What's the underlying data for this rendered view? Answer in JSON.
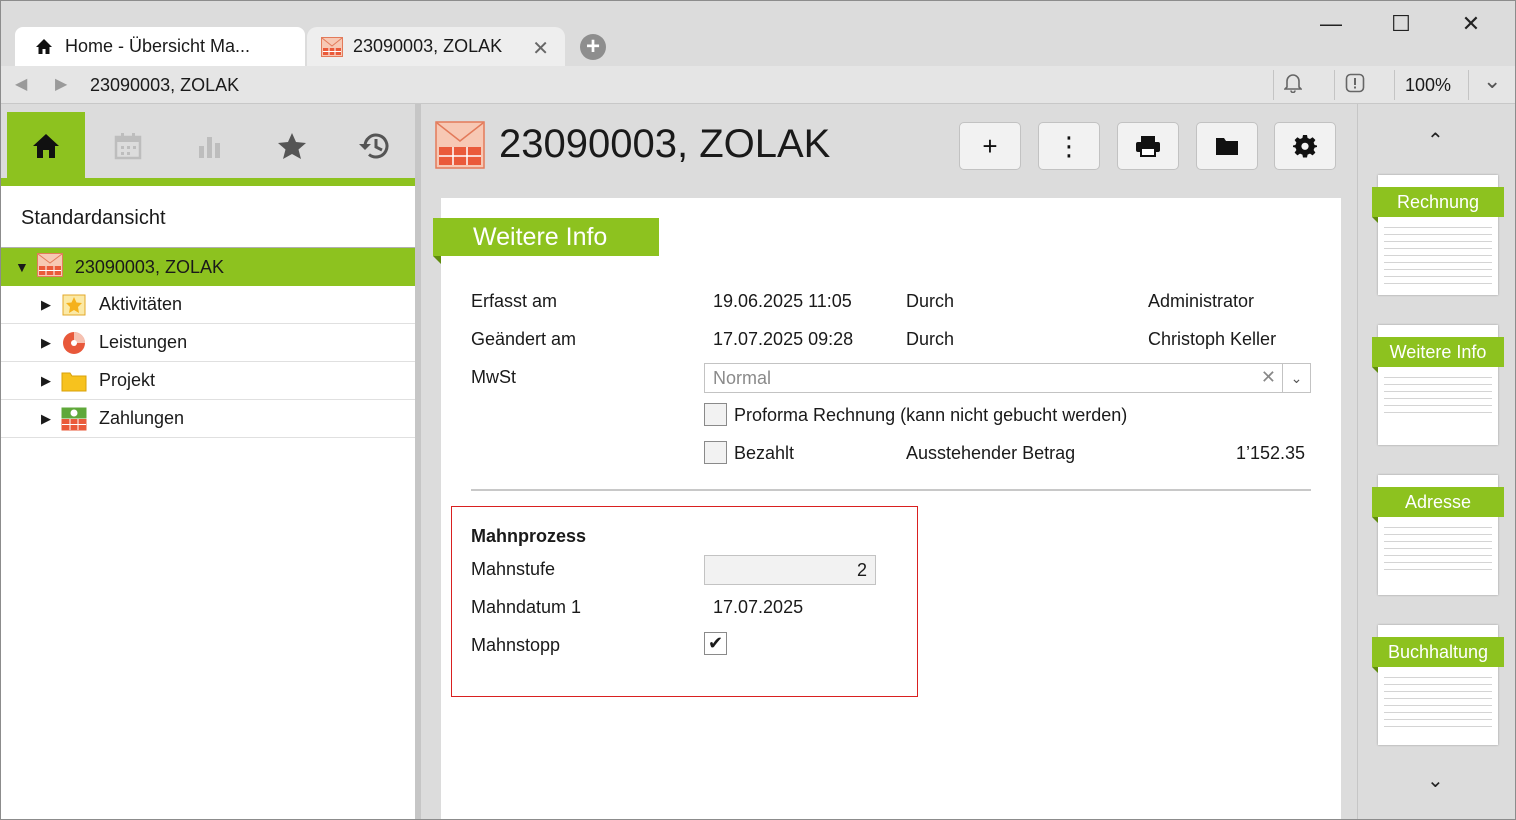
{
  "tabs": {
    "home_label": "Home - Übersicht Ma...",
    "doc_label": "23090003, ZOLAK",
    "close_glyph": "✕",
    "add_glyph": "+"
  },
  "window_controls": {
    "minimize": "—",
    "maximize": "☐",
    "close": "✕"
  },
  "addressbar": {
    "back": "◀",
    "forward": "▶",
    "path": "23090003, ZOLAK",
    "zoom": "100%",
    "dropdown": "⌄"
  },
  "sidebar": {
    "view_name": "Standardansicht",
    "tree_root": {
      "arrow": "▼",
      "label": "23090003, ZOLAK"
    },
    "tree_items": [
      {
        "arrow": "▶",
        "label": "Aktivitäten"
      },
      {
        "arrow": "▶",
        "label": "Leistungen"
      },
      {
        "arrow": "▶",
        "label": "Projekt"
      },
      {
        "arrow": "▶",
        "label": "Zahlungen"
      }
    ]
  },
  "header": {
    "title": "23090003, ZOLAK"
  },
  "toolbar": {
    "add": "+",
    "more": "⋮"
  },
  "section": {
    "title": "Weitere Info",
    "rows": {
      "erfasst_label": "Erfasst am",
      "erfasst_value": "19.06.2025 11:05",
      "erfasst_by_label": "Durch",
      "erfasst_by_value": "Administrator",
      "geaendert_label": "Geändert am",
      "geaendert_value": "17.07.2025 09:28",
      "geaendert_by_label": "Durch",
      "geaendert_by_value": "Christoph Keller",
      "mwst_label": "MwSt",
      "mwst_value": "Normal",
      "mwst_clear": "✕",
      "mwst_dropdown": "⌄",
      "proforma_label": "Proforma Rechnung (kann nicht gebucht werden)",
      "bezahlt_label": "Bezahlt",
      "ausstehend_label": "Ausstehender Betrag",
      "ausstehend_value": "1’152.35"
    },
    "mahn": {
      "title": "Mahnprozess",
      "stufe_label": "Mahnstufe",
      "stufe_value": "2",
      "datum_label": "Mahndatum 1",
      "datum_value": "17.07.2025",
      "stopp_label": "Mahnstopp",
      "stopp_check": "✔"
    }
  },
  "rail": {
    "up": "⌃",
    "down": "⌄",
    "thumbs": [
      "Rechnung",
      "Weitere Info",
      "Adresse",
      "Buchhaltung"
    ]
  },
  "colors": {
    "accent": "#8dc21f",
    "highlight_border": "#d92020"
  }
}
